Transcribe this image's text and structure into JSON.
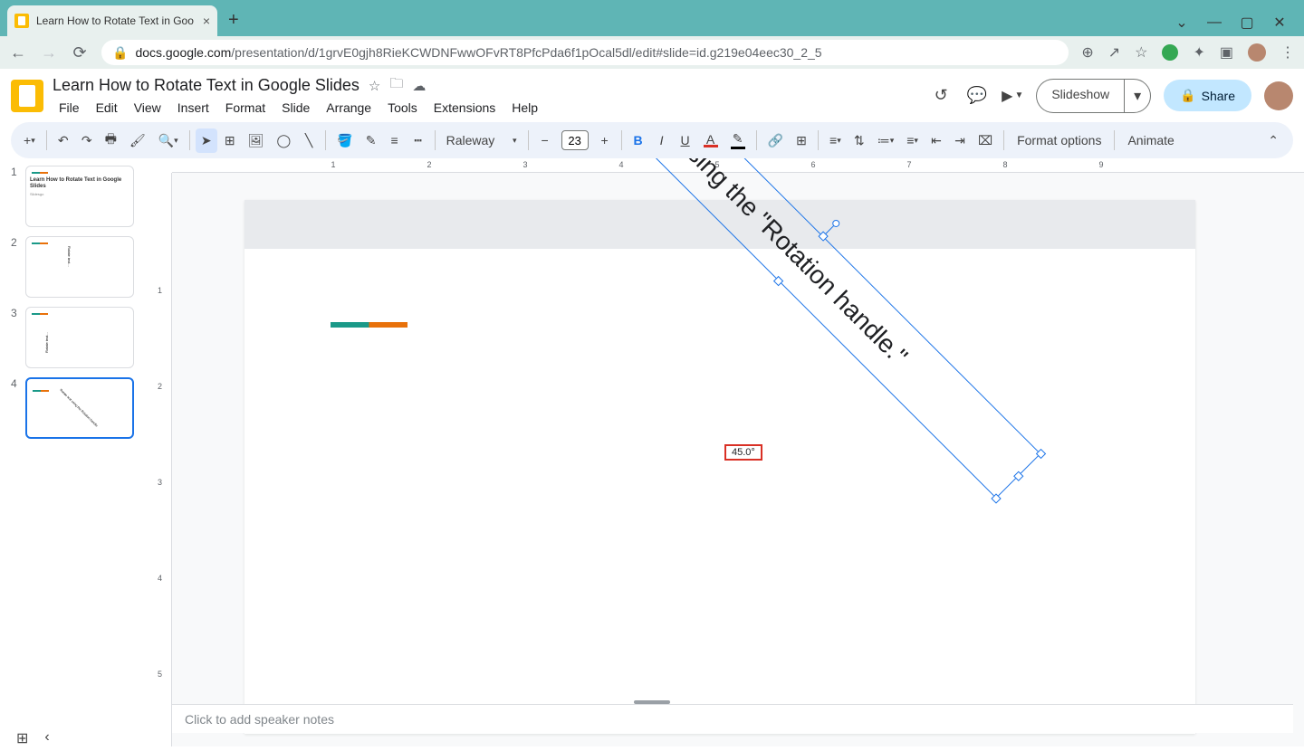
{
  "browser": {
    "tab_title": "Learn How to Rotate Text in Goo",
    "url_host": "docs.google.com",
    "url_path": "/presentation/d/1grvE0gjh8RieKCWDNFwwOFvRT8PfcPda6f1pOcal5dl/edit#slide=id.g219e04eec30_2_5"
  },
  "app": {
    "doc_title": "Learn How to Rotate Text in Google Slides",
    "menu": [
      "File",
      "Edit",
      "View",
      "Insert",
      "Format",
      "Slide",
      "Arrange",
      "Tools",
      "Extensions",
      "Help"
    ],
    "slideshow": "Slideshow",
    "share": "Share"
  },
  "toolbar": {
    "font": "Raleway",
    "fontsize": "23",
    "format_options": "Format options",
    "animate": "Animate"
  },
  "thumbs": {
    "t1_title": "Learn How to Rotate Text in Google Slides",
    "t1_sub": "Slidesgo"
  },
  "slide": {
    "textbox_text": "Rotate text using the \"Rotation handle.\"",
    "angle_badge": "45.0°"
  },
  "notes_placeholder": "Click to add speaker notes",
  "ruler_h": [
    "1",
    "2",
    "3",
    "4",
    "5",
    "6",
    "7",
    "8",
    "9"
  ],
  "ruler_v": [
    "1",
    "2",
    "3",
    "4",
    "5"
  ]
}
